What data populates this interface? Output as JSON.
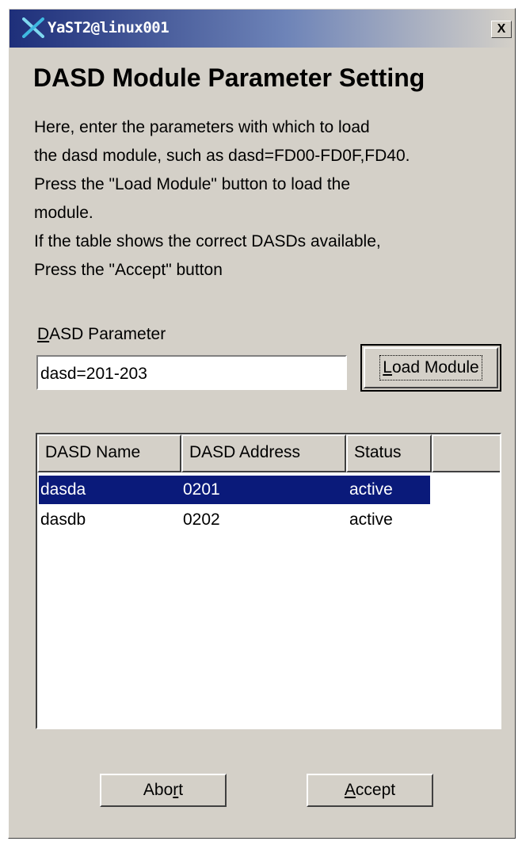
{
  "window": {
    "title": "YaST2@linux001",
    "close_symbol": "X"
  },
  "heading": "DASD Module Parameter Setting",
  "description": [
    "Here, enter the parameters with which to load",
    "the dasd module, such as dasd=FD00-FD0F,FD40.",
    "Press the \"Load Module\" button to load the",
    "module.",
    "If the table shows the correct DASDs available,",
    "Press the \"Accept\" button"
  ],
  "param": {
    "label_mnemonic": "D",
    "label_rest": "ASD Parameter",
    "value": "dasd=201-203"
  },
  "load_button": {
    "mnemonic": "L",
    "rest": "oad Module"
  },
  "table": {
    "columns": [
      "DASD Name",
      "DASD Address",
      "Status"
    ],
    "rows": [
      {
        "name": "dasda",
        "address": "0201",
        "status": "active",
        "selected": true
      },
      {
        "name": "dasdb",
        "address": "0202",
        "status": "active",
        "selected": false
      }
    ]
  },
  "buttons": {
    "abort": {
      "before": "Abo",
      "mnemonic": "r",
      "after": "t"
    },
    "accept": {
      "before": "",
      "mnemonic": "A",
      "after": "ccept"
    }
  },
  "colors": {
    "selection": "#0a1a7a",
    "dialog_background": "#d4d0c8",
    "titlebar_start": "#1e2f7a"
  },
  "icons": [
    "yast-x-logo-icon",
    "close-icon"
  ]
}
